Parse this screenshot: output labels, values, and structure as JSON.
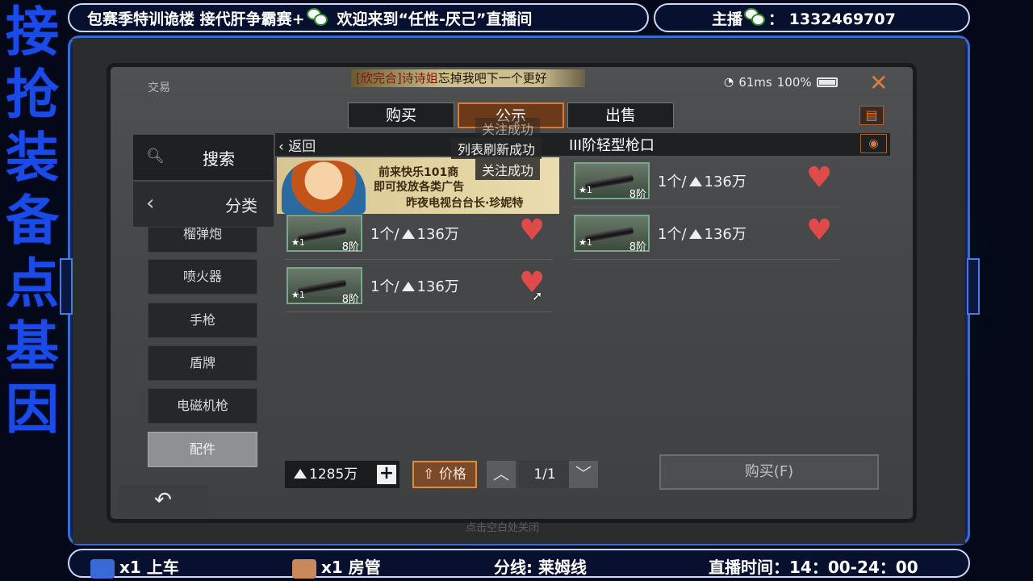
{
  "overlay": {
    "vertical_chars": [
      "接",
      "抢",
      "装",
      "备",
      "点",
      "基",
      "因"
    ],
    "top_left_a": "包赛季特训诡楼 接代肝争霸赛+",
    "top_left_b": "欢迎来到“任性-厌己”直播间",
    "top_right_label": "主播",
    "top_right_number": "： 1332469707",
    "bottom": {
      "gift1_count": "x1 上车",
      "gift2_count": "x1 房管",
      "line": "分线: 莱姆线",
      "time": "直播时间：14：00-24：00"
    },
    "colors": {
      "accent_blue": "#1a4be8",
      "frame": "#3a6ad8"
    }
  },
  "game": {
    "panel_title": "交易",
    "marquee_prefix": "[欣完合]诗诗姐",
    "marquee_text": "忘掉我吧下一个更好",
    "status": {
      "wifi_icon": "wifi-icon",
      "ping": "61ms",
      "battery": "100%"
    },
    "close_icon": "close-icon",
    "tabs": [
      {
        "label": "购买",
        "active": false
      },
      {
        "label": "公示",
        "active": true
      },
      {
        "label": "出售",
        "active": false
      }
    ],
    "toasts": [
      "关注成功",
      "列表刷新成功",
      "关注成功"
    ],
    "sidebar": {
      "search_label": "搜索",
      "category_label": "分类",
      "items": [
        "榴弹炮",
        "喷火器",
        "手枪",
        "盾牌",
        "电磁机枪",
        "配件"
      ],
      "selected": "配件"
    },
    "header": {
      "back_label": "返回",
      "title_prefix": "III阶",
      "title": "轻型枪口"
    },
    "ad": {
      "line1": "前来快乐101商",
      "line2": "即可投放各类广告",
      "line3": "昨夜电视台台长·珍妮特"
    },
    "items": [
      {
        "star": "★1",
        "tier": "8阶",
        "price_qty": "1个/",
        "price": "136万",
        "favorited": true
      },
      {
        "star": "★1",
        "tier": "8阶",
        "price_qty": "1个/",
        "price": "136万",
        "favorited": true
      },
      {
        "star": "★1",
        "tier": "8阶",
        "price_qty": "1个/",
        "price": "136万",
        "favorited": true
      },
      {
        "star": "★1",
        "tier": "8阶",
        "price_qty": "1个/",
        "price": "136万",
        "favorited": true
      },
      {
        "star": "★1",
        "tier": "8阶",
        "price_qty": "1个/",
        "price": "136万",
        "favorited": true
      }
    ],
    "bottom": {
      "money": "1285万",
      "sort_label": "价格",
      "page": "1/1",
      "buy_button": "购买(F)",
      "close_hint": "点击空白处关闭"
    }
  }
}
